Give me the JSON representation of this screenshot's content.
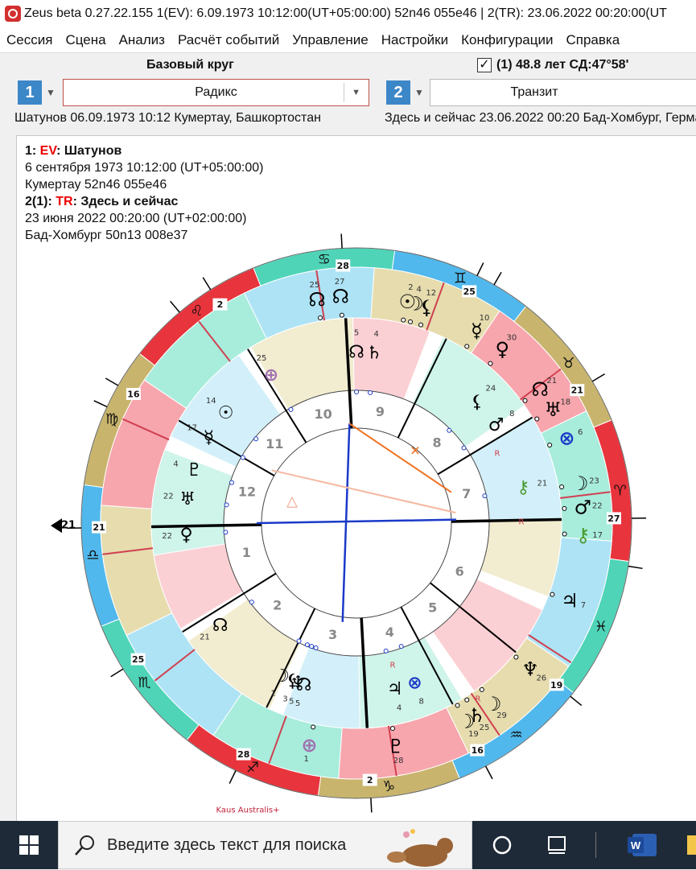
{
  "window": {
    "title": "Zeus beta   0.27.22.155    1(EV): 6.09.1973 10:12:00(UT+05:00:00) 52n46 055e46   | 2(TR): 23.06.2022 00:20:00(UT"
  },
  "menu": [
    "Сессия",
    "Сцена",
    "Анализ",
    "Расчёт событий",
    "Управление",
    "Настройки",
    "Конфигурации",
    "Справка"
  ],
  "left_panel": {
    "title": "Базовый круг",
    "number": "1",
    "combo_value": "Радикс",
    "subline": "Шатунов 06.09.1973 10:12 Кумертау, Башкортостан"
  },
  "right_panel": {
    "checkbox_mark": "✓",
    "title": "(1) 48.8 лет СД:47°58'",
    "number": "2",
    "combo_value": "Транзит",
    "subline": "Здесь и сейчас 23.06.2022 00:20 Бад-Хомбург, Германия"
  },
  "info": {
    "l1_prefix": "1: ",
    "l1_tag": "EV",
    "l1_name": ": Шатунов",
    "l2": "6 сентября 1973 10:12:00 (UT+05:00:00)",
    "l3": "Кумертау 52n46 055e46",
    "l4_prefix": "2(1): ",
    "l4_tag": "TR",
    "l4_name": ": Здесь и сейчас",
    "l5": "23 июня 2022 00:20:00 (UT+02:00:00)",
    "l6": "Бад-Хомбург 50n13 008e37"
  },
  "chart": {
    "sign_glyphs": [
      "♈",
      "♉",
      "♊",
      "♋",
      "♌",
      "♍",
      "♎",
      "♏",
      "♐",
      "♑",
      "♒",
      "♓"
    ],
    "sign_colors": [
      "#e8343c",
      "#c8b46c",
      "#50b8ec",
      "#4fd4b8"
    ],
    "house_numbers": [
      "1",
      "2",
      "3",
      "4",
      "5",
      "6",
      "7",
      "8",
      "9",
      "10",
      "11",
      "12"
    ],
    "outer_cusp_labels": [
      "21",
      "25",
      "28",
      "2",
      "16",
      "19",
      "27",
      "21",
      "25",
      "28",
      "2",
      "16",
      "19",
      "27",
      "25",
      "30",
      "16",
      "26",
      "16",
      "30",
      "26"
    ],
    "transit_planets": [
      {
        "glyph": "☊",
        "deg": "27"
      },
      {
        "glyph": "☊",
        "deg": "25"
      },
      {
        "glyph": "⚸",
        "deg": "12"
      },
      {
        "glyph": "☽",
        "deg": "4"
      },
      {
        "glyph": "☉",
        "deg": "2"
      },
      {
        "glyph": "☿",
        "deg": "10"
      },
      {
        "glyph": "♀",
        "deg": "30"
      },
      {
        "glyph": "☊",
        "deg": "21"
      },
      {
        "glyph": "♅",
        "deg": "18"
      },
      {
        "glyph": "⊗",
        "deg": "6"
      },
      {
        "glyph": "☽",
        "deg": "23"
      },
      {
        "glyph": "♂",
        "deg": "22"
      },
      {
        "glyph": "⚷",
        "deg": "17"
      },
      {
        "glyph": "♃",
        "deg": "7"
      },
      {
        "glyph": "♆",
        "deg": "26"
      },
      {
        "glyph": "☽",
        "deg": "29"
      },
      {
        "glyph": "♄",
        "deg": "25"
      },
      {
        "glyph": "☽",
        "deg": "19"
      },
      {
        "glyph": "♇",
        "deg": "28"
      },
      {
        "glyph": "⊕",
        "deg": "1"
      }
    ],
    "radix_planets": [
      {
        "glyph": "☊",
        "deg": "5"
      },
      {
        "glyph": "♄",
        "deg": "4"
      },
      {
        "glyph": "⊕",
        "deg": "25"
      },
      {
        "glyph": "☉",
        "deg": "14"
      },
      {
        "glyph": "☿",
        "deg": "17"
      },
      {
        "glyph": "♇",
        "deg": "4"
      },
      {
        "glyph": "♅",
        "deg": "22"
      },
      {
        "glyph": "♀",
        "deg": "22"
      },
      {
        "glyph": "⚸",
        "deg": "24"
      },
      {
        "glyph": "♂",
        "deg": "8"
      },
      {
        "glyph": "⚷",
        "deg": "21"
      },
      {
        "glyph": "♆",
        "deg": "5"
      },
      {
        "glyph": "☊",
        "deg": "21"
      },
      {
        "glyph": "☽",
        "deg": "1"
      },
      {
        "glyph": "⚸",
        "deg": "3"
      },
      {
        "glyph": "☊",
        "deg": "5"
      },
      {
        "glyph": "♃",
        "deg": "4"
      },
      {
        "glyph": "⊗",
        "deg": "8"
      }
    ],
    "retro_mark": "R",
    "fixed_star": "Kaus Australis"
  },
  "taskbar": {
    "search_placeholder": "Введите здесь текст для поиска"
  }
}
